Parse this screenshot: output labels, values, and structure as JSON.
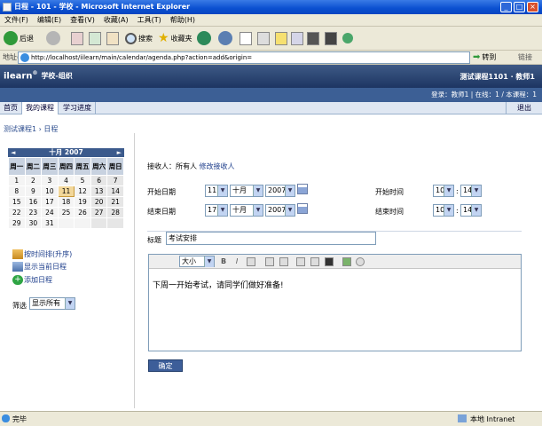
{
  "window": {
    "title": "日程 - 101 - 学校 - Microsoft Internet Explorer"
  },
  "menu": [
    "文件(F)",
    "编辑(E)",
    "查看(V)",
    "收藏(A)",
    "工具(T)",
    "帮助(H)"
  ],
  "toolbar": {
    "back": "后退",
    "search": "搜索",
    "favorites": "收藏夹"
  },
  "address": {
    "label": "地址(D)",
    "url": "http://localhost/iilearn/main/calendar/agenda.php?action=add&origin=",
    "go": "转到",
    "links": "链接"
  },
  "site": {
    "logo": "ilearn",
    "logo_mark": "®",
    "org": "学校-组织",
    "course_user": "测试课程1101 · 教师1",
    "status_line": "登录：教师1 | 在线：1 / 本课程：1",
    "nav": [
      "首页",
      "我的课程",
      "学习进度"
    ],
    "logout": "退出",
    "breadcrumb": "测试课程1 › 日程"
  },
  "calendar": {
    "prev": "◄",
    "next": "►",
    "month_label": "十月 2007",
    "weekdays": [
      "周一",
      "周二",
      "周三",
      "周四",
      "周五",
      "周六",
      "周日"
    ],
    "weeks": [
      [
        "1",
        "2",
        "3",
        "4",
        "5",
        "6",
        "7"
      ],
      [
        "8",
        "9",
        "10",
        "11",
        "12",
        "13",
        "14"
      ],
      [
        "15",
        "16",
        "17",
        "18",
        "19",
        "20",
        "21"
      ],
      [
        "22",
        "23",
        "24",
        "25",
        "26",
        "27",
        "28"
      ],
      [
        "29",
        "30",
        "31",
        "",
        "",
        "",
        ""
      ]
    ],
    "today": "11"
  },
  "sidebar": {
    "sort_link": "按时间排(升序)",
    "show_today_link": "显示当前日程",
    "add_link": "添加日程",
    "filter_label": "筛选",
    "filter_value": "显示所有"
  },
  "form": {
    "recipients_label": "接收人：所有人",
    "recipients_link": "修改接收人",
    "start_date_label": "开始日期",
    "start_day": "11",
    "start_month": "十月",
    "start_year": "2007",
    "end_date_label": "结束日期",
    "end_day": "17",
    "end_month": "十月",
    "end_year": "2007",
    "start_time_label": "开始时间",
    "start_hour": "10",
    "start_minute": "14",
    "end_time_label": "结束时间",
    "end_hour": "10",
    "end_minute": "14",
    "time_sep": ":",
    "title_label": "标题",
    "title_value": "考试安排",
    "editor_size": "大小",
    "editor_bold": "B",
    "editor_italic": "I",
    "body": "下周一开始考试，请同学们做好准备!",
    "submit": "确定"
  },
  "status": {
    "text": "完毕",
    "zone": "本地 Intranet"
  }
}
